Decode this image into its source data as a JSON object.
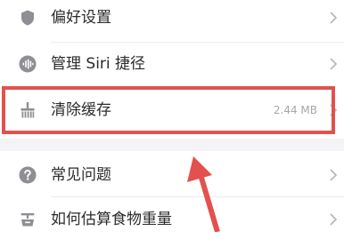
{
  "settings": {
    "items": [
      {
        "label": "偏好设置",
        "value": "",
        "icon": "shield-icon"
      },
      {
        "label": "管理 Siri 捷径",
        "value": "",
        "icon": "siri-waveform-icon"
      },
      {
        "label": "清除缓存",
        "value": "2.44 MB",
        "icon": "broom-icon"
      },
      {
        "label": "常见问题",
        "value": "",
        "icon": "question-circle-icon"
      },
      {
        "label": "如何估算食物重量",
        "value": "",
        "icon": "scale-icon"
      }
    ]
  },
  "colors": {
    "icon": "#8e8e93",
    "label": "#2b2b2b",
    "value": "#a6a6a6",
    "annotation": "#e2514e",
    "group_gap": "#f4f4f6"
  }
}
